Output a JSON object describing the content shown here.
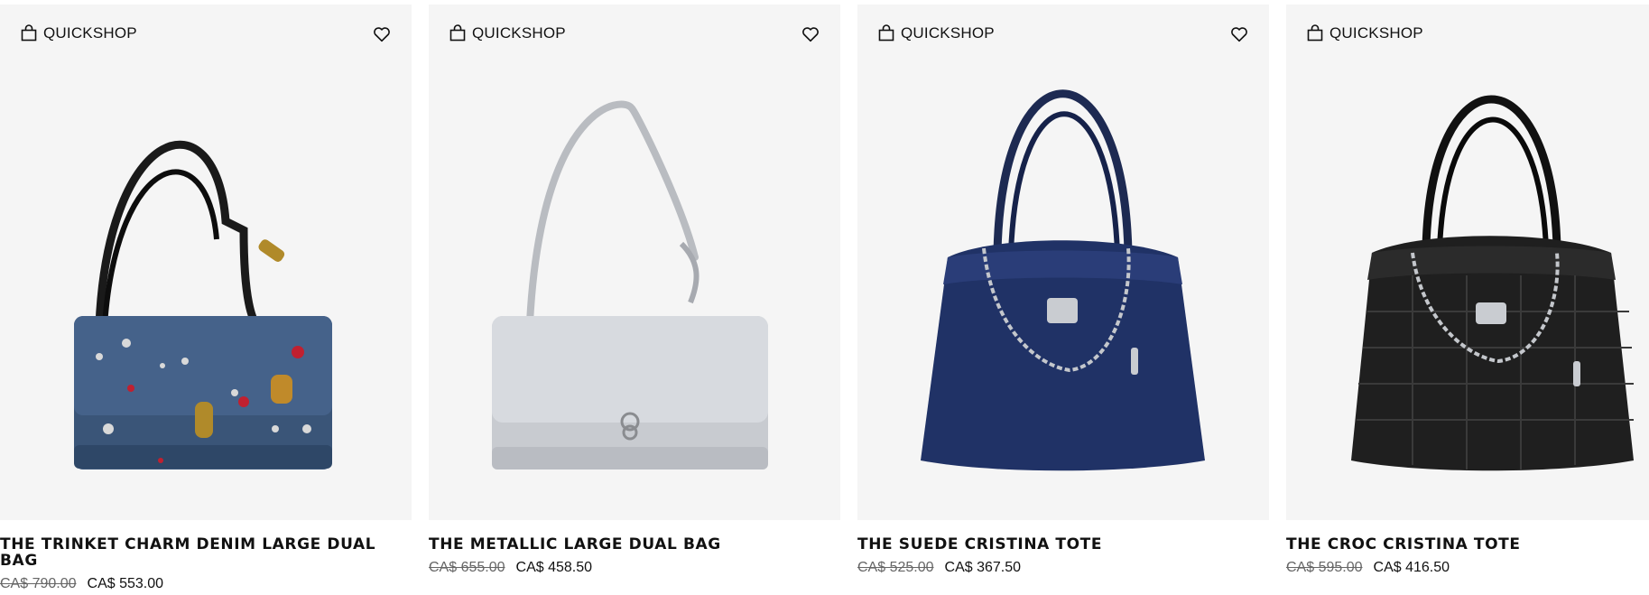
{
  "quickshop_label": "QUICKSHOP",
  "products": [
    {
      "name": "THE TRINKET CHARM DENIM LARGE DUAL BAG",
      "original_price": "CA$ 790.00",
      "sale_price": "CA$ 553.00",
      "image": "denim-bag-image"
    },
    {
      "name": "THE METALLIC LARGE DUAL BAG",
      "original_price": "CA$ 655.00",
      "sale_price": "CA$ 458.50",
      "image": "silver-bag-image"
    },
    {
      "name": "THE SUEDE CRISTINA TOTE",
      "original_price": "CA$ 525.00",
      "sale_price": "CA$ 367.50",
      "image": "navy-suede-tote-image"
    },
    {
      "name": "THE CROC CRISTINA TOTE",
      "original_price": "CA$ 595.00",
      "sale_price": "CA$ 416.50",
      "image": "black-croc-tote-image"
    }
  ],
  "colors": {
    "tile_background": "#f5f5f5",
    "text": "#111111",
    "strike_price": "#666666"
  }
}
